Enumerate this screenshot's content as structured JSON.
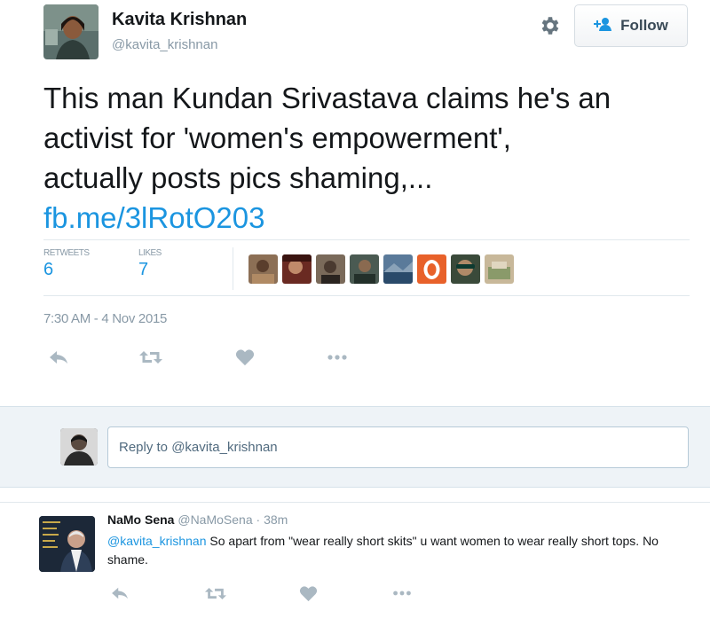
{
  "tweet": {
    "author_name": "Kavita Krishnan",
    "author_handle": "@kavita_krishnan",
    "follow_label": "Follow",
    "text_lines": [
      "This man Kundan Srivastava claims he's an",
      "activist for 'women's empowerment',",
      "actually posts pics shaming,..."
    ],
    "link": "fb.me/3lRotO203",
    "retweets_label": "RETWEETS",
    "retweets_count": "6",
    "likes_label": "LIKES",
    "likes_count": "7",
    "timestamp": "7:30 AM - 4 Nov 2015"
  },
  "reply_box": {
    "placeholder": "Reply to @kavita_krishnan"
  },
  "reply": {
    "author_name": "NaMo Sena",
    "author_handle": "@NaMoSena",
    "separator": "·",
    "time": "38m",
    "mention": "@kavita_krishnan",
    "text": " So apart from \"wear really short skits\" u want women to wear really short tops. No shame."
  },
  "icons": {
    "gear": "gear-icon",
    "follow": "add-user-icon",
    "reply": "reply-icon",
    "retweet": "retweet-icon",
    "like": "heart-icon",
    "more": "more-icon"
  },
  "colors": {
    "link_blue": "#1b95e0",
    "muted_gray": "#8899a6",
    "action_gray": "#aab8c2",
    "reply_bg": "#eef3f7"
  }
}
